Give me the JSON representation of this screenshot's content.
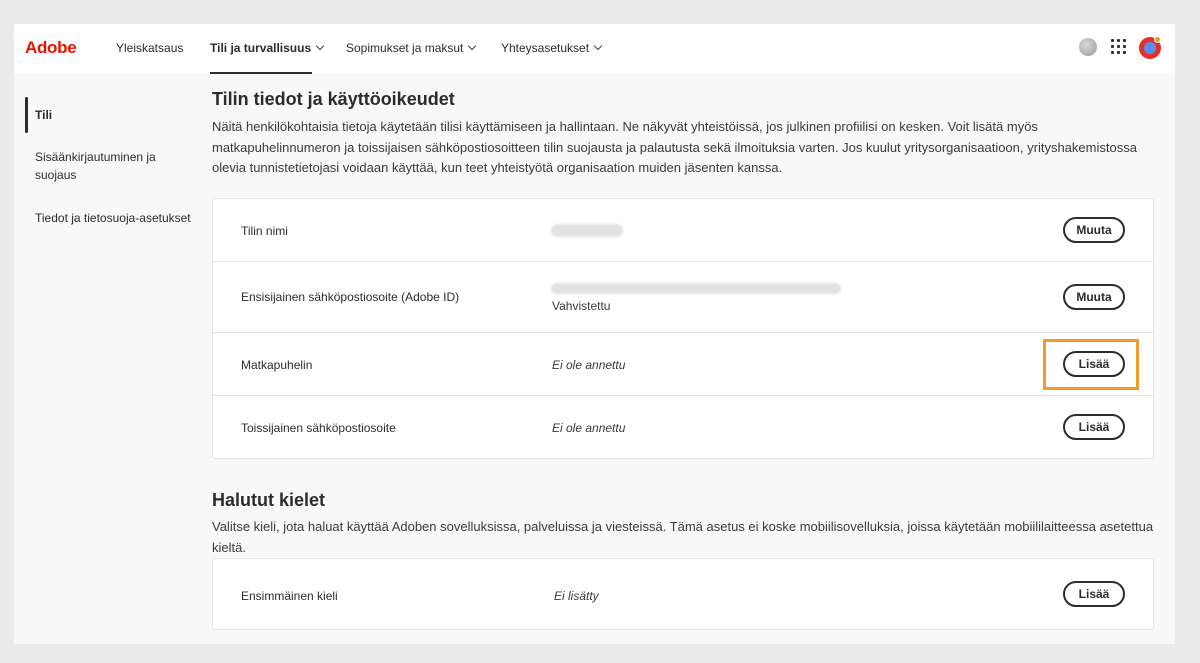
{
  "header": {
    "logo": "Adobe",
    "nav": [
      {
        "label": "Yleiskatsaus"
      },
      {
        "label": "Tili ja turvallisuus"
      },
      {
        "label": "Sopimukset ja maksut"
      },
      {
        "label": "Yhteysasetukset"
      }
    ]
  },
  "sidebar": {
    "items": [
      {
        "label": "Tili"
      },
      {
        "label": "Sisäänkirjautuminen ja suojaus"
      },
      {
        "label": "Tiedot ja tietosuoja-asetukset"
      }
    ]
  },
  "account": {
    "title": "Tilin tiedot ja käyttöoikeudet",
    "description": "Näitä henkilökohtaisia tietoja käytetään tilisi käyttämiseen ja hallintaan. Ne näkyvät yhteistöissä, jos julkinen profiilisi on kesken. Voit lisätä myös matkapuhelinnumeron ja toissijaisen sähköpostiosoitteen tilin suojausta ja palautusta sekä ilmoituksia varten. Jos kuulut yritysorganisaatioon, yrityshakemistossa olevia tunnistetietojasi voidaan käyttää, kun teet yhteistyötä organisaation muiden jäsenten kanssa.",
    "rows": [
      {
        "label": "Tilin nimi",
        "value": "",
        "button": "Muuta"
      },
      {
        "label": "Ensisijainen sähköpostiosoite (Adobe ID)",
        "value": "",
        "status": "Vahvistettu",
        "button": "Muuta"
      },
      {
        "label": "Matkapuhelin",
        "value": "Ei ole annettu",
        "button": "Lisää"
      },
      {
        "label": "Toissijainen sähköpostiosoite",
        "value": "Ei ole annettu",
        "button": "Lisää"
      }
    ]
  },
  "languages": {
    "title": "Halutut kielet",
    "description": "Valitse kieli, jota haluat käyttää Adoben sovelluksissa, palveluissa ja viesteissä. Tämä asetus ei koske mobiilisovelluksia, joissa käytetään mobiililaitteessa asetettua kieltä.",
    "rows": [
      {
        "label": "Ensimmäinen kieli",
        "value": "Ei lisätty",
        "button": "Lisää"
      }
    ]
  },
  "colors": {
    "brand": "#eb1000",
    "highlight": "#f29a2e"
  }
}
